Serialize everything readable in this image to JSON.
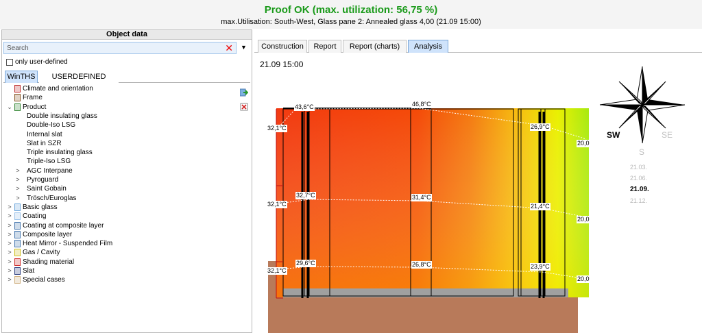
{
  "header": {
    "title": "Proof OK (max. utilization: 56,75 %)",
    "subtitle": "max.Utilisation: South-West, Glass pane 2: Annealed glass 4,00 (21.09 15:00)"
  },
  "left_panel": {
    "title": "Object data",
    "search_placeholder": "Search",
    "only_user_defined": "only user-defined",
    "tabs": [
      "WinTHS",
      "USERDEFINED"
    ],
    "tree": [
      {
        "label": "Climate and orientation",
        "level": 0,
        "expander": "",
        "icon": "thermometer-icon"
      },
      {
        "label": "Frame",
        "level": 0,
        "expander": "",
        "icon": "frame-icon"
      },
      {
        "label": "Product",
        "level": 0,
        "expander": "⌄",
        "icon": "product-icon"
      },
      {
        "label": "Double insulating glass",
        "level": 1,
        "expander": ""
      },
      {
        "label": "Double-Iso LSG",
        "level": 1,
        "expander": ""
      },
      {
        "label": "Internal slat",
        "level": 1,
        "expander": ""
      },
      {
        "label": "Slat in SZR",
        "level": 1,
        "expander": ""
      },
      {
        "label": "Triple insulating glass",
        "level": 1,
        "expander": ""
      },
      {
        "label": "Triple-Iso LSG",
        "level": 1,
        "expander": ""
      },
      {
        "label": "AGC Interpane",
        "level": 1,
        "expander": ">"
      },
      {
        "label": "Pyroguard",
        "level": 1,
        "expander": ">"
      },
      {
        "label": "Saint Gobain",
        "level": 1,
        "expander": ">"
      },
      {
        "label": "Trösch/Euroglas",
        "level": 1,
        "expander": ">"
      },
      {
        "label": "Basic glass",
        "level": 0,
        "expander": ">",
        "icon": "basic-glass-icon"
      },
      {
        "label": "Coating",
        "level": 0,
        "expander": ">",
        "icon": "coating-icon"
      },
      {
        "label": "Coating at composite layer",
        "level": 0,
        "expander": ">",
        "icon": "coating-composite-icon"
      },
      {
        "label": "Composite layer",
        "level": 0,
        "expander": ">",
        "icon": "composite-layer-icon"
      },
      {
        "label": "Heat Mirror - Suspended Film",
        "level": 0,
        "expander": ">",
        "icon": "heat-mirror-icon"
      },
      {
        "label": "Gas / Cavity",
        "level": 0,
        "expander": ">",
        "icon": "gas-icon"
      },
      {
        "label": "Shading material",
        "level": 0,
        "expander": ">",
        "icon": "shading-icon"
      },
      {
        "label": "Slat",
        "level": 0,
        "expander": ">",
        "icon": "slat-icon"
      },
      {
        "label": "Special cases",
        "level": 0,
        "expander": ">",
        "icon": "special-cases-icon"
      }
    ]
  },
  "right_panel": {
    "tabs": [
      "Construction",
      "Report",
      "Report (charts)",
      "Analysis"
    ],
    "selected_tab": "Analysis",
    "datetime": "21.09 15:00",
    "temperatures": {
      "top_row": [
        "43,6°C",
        "46,8°C",
        "26,9°C"
      ],
      "middle_row": [
        "32,7°C",
        "31,4°C",
        "21,4°C"
      ],
      "bottom_row": [
        "29,6°C",
        "26,8°C",
        "23,9°C"
      ],
      "left_edge": [
        "32,1°C",
        "32,1°C",
        "32,1°C"
      ],
      "right_edge": [
        "20,0",
        "20,0",
        "20,0"
      ]
    },
    "compass": {
      "sw": "SW",
      "se": "SE",
      "s": "S"
    },
    "dates": [
      "21.03.",
      "21.06.",
      "21.09.",
      "21.12."
    ],
    "selected_date": "21.09."
  },
  "colors": {
    "title_green": "#1a9a1a",
    "tab_selected": "#cfe3fb",
    "soil": "#b87a5a"
  }
}
